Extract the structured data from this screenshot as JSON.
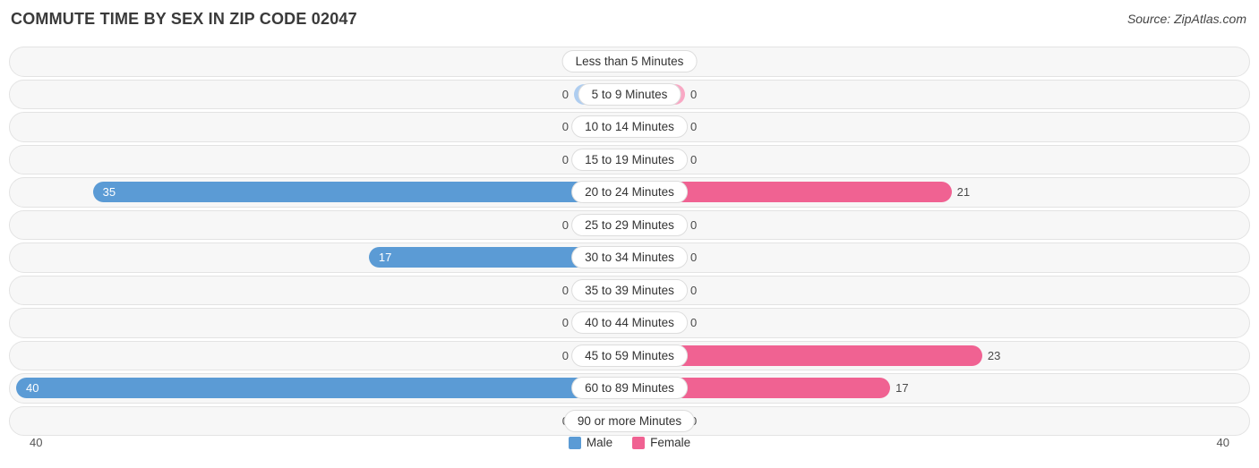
{
  "header": {
    "title": "COMMUTE TIME BY SEX IN ZIP CODE 02047",
    "source": "Source: ZipAtlas.com"
  },
  "legend": {
    "male_label": "Male",
    "female_label": "Female",
    "male_color": "#5b9bd5",
    "female_color": "#f06292"
  },
  "axis": {
    "left_tick": "40",
    "right_tick": "40"
  },
  "chart_data": {
    "type": "bar",
    "orientation": "horizontal-diverging",
    "title": "COMMUTE TIME BY SEX IN ZIP CODE 02047",
    "xlabel": "",
    "ylabel": "",
    "xlim": [
      40,
      40
    ],
    "grid": false,
    "legend_position": "bottom-center",
    "categories": [
      "Less than 5 Minutes",
      "5 to 9 Minutes",
      "10 to 14 Minutes",
      "15 to 19 Minutes",
      "20 to 24 Minutes",
      "25 to 29 Minutes",
      "30 to 34 Minutes",
      "35 to 39 Minutes",
      "40 to 44 Minutes",
      "45 to 59 Minutes",
      "60 to 89 Minutes",
      "90 or more Minutes"
    ],
    "series": [
      {
        "name": "Male",
        "color": "#5b9bd5",
        "values": [
          0,
          0,
          0,
          0,
          35,
          0,
          17,
          0,
          0,
          0,
          40,
          0
        ]
      },
      {
        "name": "Female",
        "color": "#f06292",
        "values": [
          0,
          0,
          0,
          0,
          21,
          0,
          0,
          0,
          0,
          23,
          17,
          0
        ]
      }
    ],
    "value_labels": {
      "male": [
        "0",
        "0",
        "0",
        "0",
        "35",
        "0",
        "17",
        "0",
        "0",
        "0",
        "40",
        "0"
      ],
      "female": [
        "0",
        "0",
        "0",
        "0",
        "21",
        "0",
        "0",
        "0",
        "0",
        "23",
        "17",
        "0"
      ]
    }
  }
}
